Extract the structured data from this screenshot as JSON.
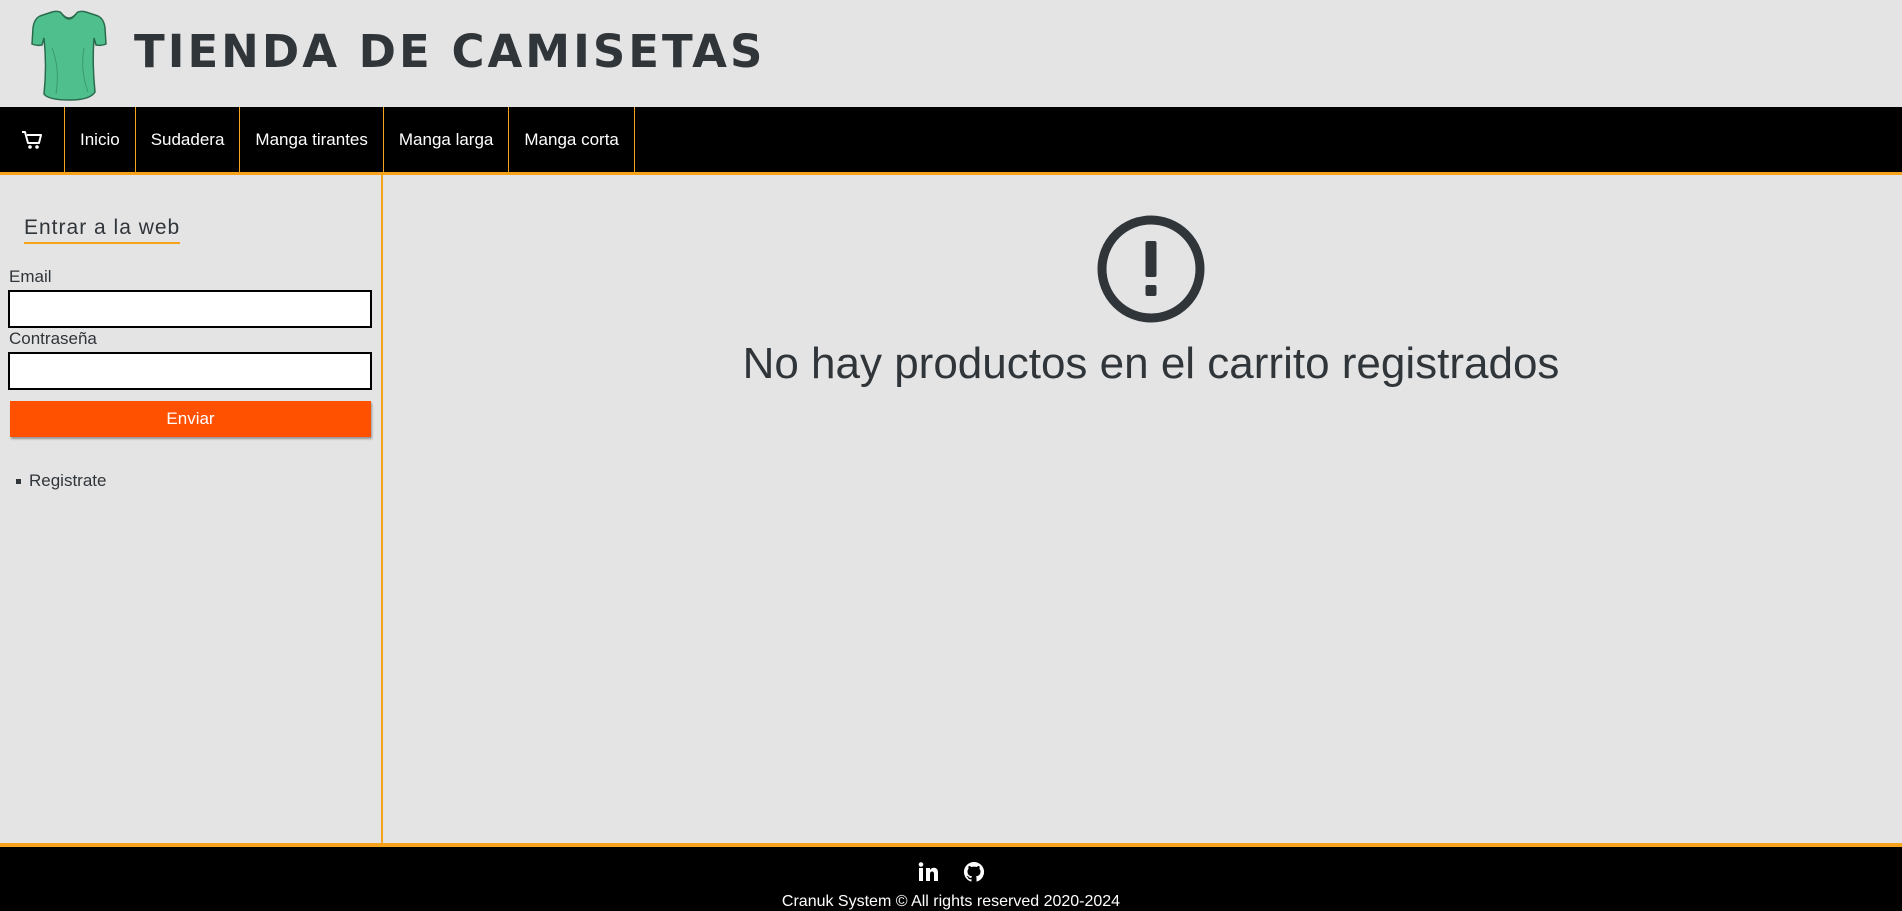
{
  "header": {
    "logo_icon": "green-tshirt-icon",
    "site_title": "TIENDA DE CAMISETAS"
  },
  "nav": {
    "cart_icon": "shopping-cart-icon",
    "items": [
      {
        "label": "Inicio"
      },
      {
        "label": "Sudadera"
      },
      {
        "label": "Manga tirantes"
      },
      {
        "label": "Manga larga"
      },
      {
        "label": "Manga corta"
      }
    ]
  },
  "sidebar": {
    "title": "Entrar a la web",
    "email_label": "Email",
    "email_value": "",
    "password_label": "Contraseña",
    "password_value": "",
    "submit_label": "Enviar",
    "register_label": "Registrate"
  },
  "main": {
    "alert_icon": "exclamation-circle-icon",
    "empty_message": "No hay productos en el carrito registrados"
  },
  "footer": {
    "social_icons": [
      "linkedin-icon",
      "github-icon"
    ],
    "copyright": "Cranuk System © All rights reserved 2020-2024"
  },
  "colors": {
    "background": "#e4e4e4",
    "nav_background": "#000000",
    "accent_border": "#f7a21b",
    "button": "#ff5100",
    "text": "#30353a",
    "logo_shirt": "#4fc08d"
  }
}
